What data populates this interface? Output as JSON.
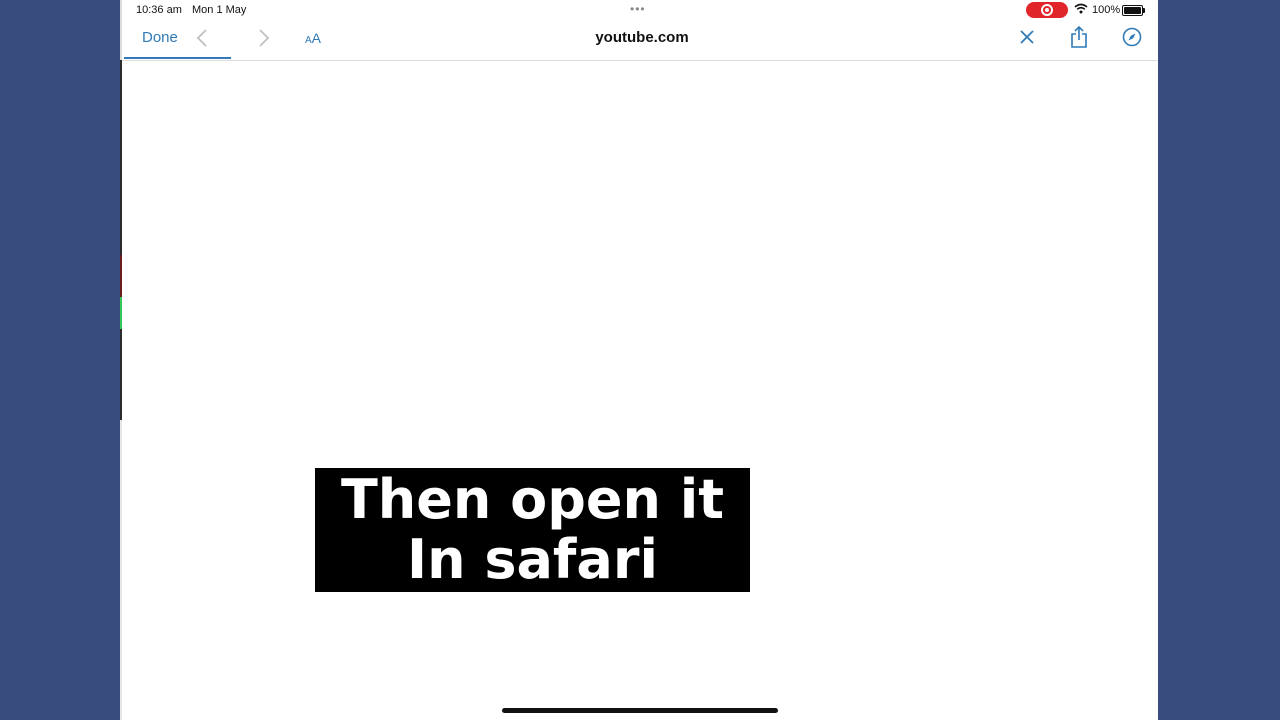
{
  "status_bar": {
    "time": "10:36 am",
    "date": "Mon 1 May",
    "dots": "•••",
    "battery": "100%"
  },
  "toolbar": {
    "done_label": "Done",
    "text_size_small": "A",
    "text_size_big": "A",
    "url": "youtube.com",
    "icons": [
      "chevron-left-icon",
      "chevron-right-icon",
      "close-icon",
      "share-icon",
      "compass-icon"
    ]
  },
  "caption": {
    "line1": "Then open it",
    "line2": "In safari"
  },
  "colors": {
    "background": "#374c7c",
    "accent": "#2f7ab7",
    "record": "#e0262b"
  }
}
